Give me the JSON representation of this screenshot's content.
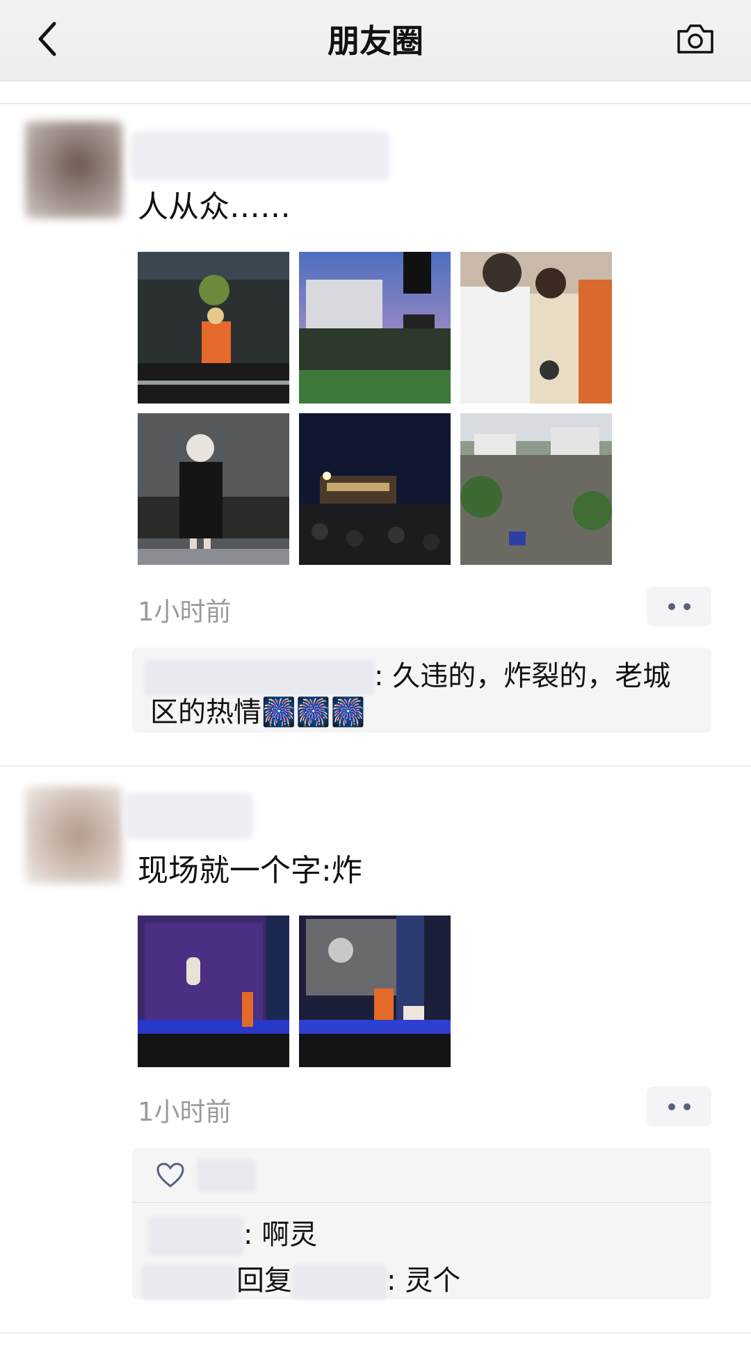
{
  "header": {
    "title": "朋友圈",
    "back_icon": "chevron-left-icon",
    "camera_icon": "camera-icon"
  },
  "posts": [
    {
      "text": "人从众……",
      "time": "1小时前",
      "photo_count": 6,
      "comments": [
        {
          "text_line1": ": 久违的，炸裂的，老城",
          "text_line2": "区的热情",
          "emoji": "🎆🎆🎆"
        }
      ]
    },
    {
      "text": "现场就一个字:炸",
      "time": "1小时前",
      "photo_count": 2,
      "like_icon": "heart-icon",
      "comments": [
        {
          "text": ": 啊灵"
        },
        {
          "reply_word": "回复",
          "text": ": 灵个"
        }
      ]
    }
  ],
  "colors": {
    "header_bg": "#ededed",
    "comment_bg": "#f5f5f5",
    "link_blue": "#56617e",
    "time_gray": "#9a9a9a"
  }
}
